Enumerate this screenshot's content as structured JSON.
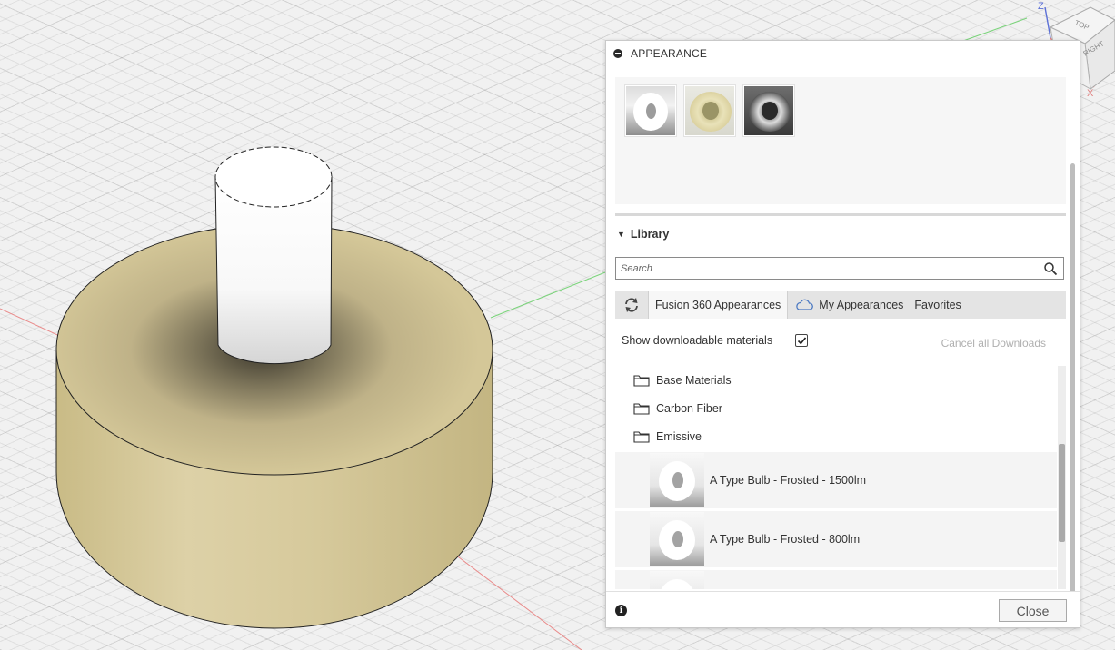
{
  "viewcube": {
    "face_top": "TOP",
    "face_right": "RIGHT",
    "axis_z": "Z",
    "axis_x": "X"
  },
  "panel": {
    "title": "APPEARANCE",
    "in_model_materials": [
      {
        "icon": "white-bulb-swatch-icon"
      },
      {
        "icon": "cream-ring-swatch-icon"
      },
      {
        "icon": "chrome-ring-swatch-icon"
      }
    ],
    "library": {
      "heading": "Library",
      "search_placeholder": "Search",
      "tabs": {
        "fusion": "Fusion 360 Appearances",
        "my": "My Appearances",
        "favorites": "Favorites"
      },
      "show_downloadable_label": "Show downloadable materials",
      "show_downloadable_checked": true,
      "cancel_downloads_label": "Cancel all Downloads",
      "folders": [
        "Base Materials",
        "Carbon Fiber",
        "Emissive"
      ],
      "materials": [
        "A Type Bulb - Frosted - 1500lm",
        "A Type Bulb - Frosted - 800lm",
        ""
      ]
    },
    "footer": {
      "info_icon": "i",
      "close_label": "Close"
    }
  },
  "colors": {
    "body_tan": "#d2c597",
    "axis_red": "#e98a8a",
    "axis_green": "#7ad47a",
    "panel_bg": "#ffffff"
  }
}
